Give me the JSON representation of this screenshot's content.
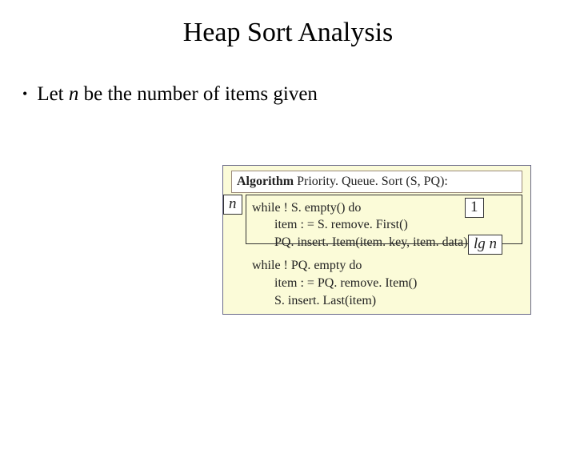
{
  "title": "Heap Sort Analysis",
  "bullet_prefix": "Let ",
  "bullet_var": "n",
  "bullet_suffix": " be the number of items given",
  "algo": {
    "kw": "Algorithm",
    "signature": "Priority. Queue. Sort (S, PQ):",
    "loop1": {
      "while": "while ! S. empty() do",
      "l1": "item : = S. remove. First()",
      "l2": "PQ. insert. Item(item. key, item. data)"
    },
    "loop2": {
      "while": "while ! PQ. empty do",
      "l1": "item : = PQ. remove. Item()",
      "l2": "S. insert. Last(item)"
    }
  },
  "annot": {
    "n": "n",
    "one": "1",
    "lgn": "lg n"
  }
}
